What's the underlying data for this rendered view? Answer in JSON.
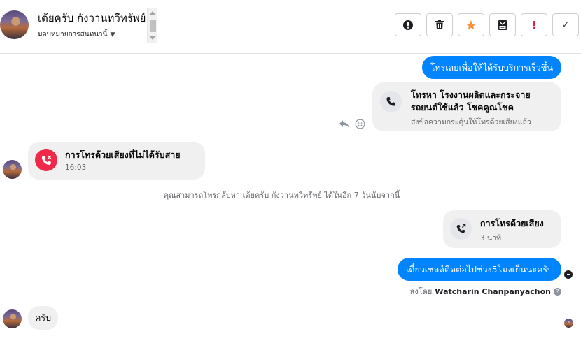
{
  "header": {
    "contact_name": "เด้ยครับ กังวานทวีทรัพย์",
    "assign_label": "มอบหมายการสนทนานี้",
    "toolbar": [
      {
        "name": "spam-button",
        "icon": "alert-circle-icon",
        "glyph": "!"
      },
      {
        "name": "delete-button",
        "icon": "trash-icon",
        "glyph": ""
      },
      {
        "name": "star-button",
        "icon": "star-icon",
        "glyph": "★"
      },
      {
        "name": "archive-button",
        "icon": "archive-mail-icon",
        "glyph": ""
      },
      {
        "name": "mark-important-button",
        "icon": "exclamation-icon",
        "glyph": "!"
      },
      {
        "name": "mark-done-button",
        "icon": "check-icon",
        "glyph": "✓"
      }
    ]
  },
  "messages": {
    "call_prompt": "โทรเลยเพื่อให้ได้รับบริการเร็วขึ้น",
    "call_card": {
      "title_line1": "โทรหา โรงงานผลิตและกระจาย",
      "title_line2": "รถยนต์ใช้แล้ว โชคคูณโชค",
      "subtitle": "ส่งข้อความกระตุ้นให้โทรด้วยเสียงแล้ว"
    },
    "missed_call": {
      "title": "การโทรด้วยเสียงที่ไม่ได้รับสาย",
      "time": "16:03"
    },
    "callback_note": "คุณสามารถโทรกลับหา เด้ยครับ กังวานทวีทรัพย์ ได้ในอีก 7 วันนับจากนี้",
    "voice_call": {
      "title": "การโทรด้วยเสียง",
      "duration": "3 นาที"
    },
    "followup_message": "เดี๋ยวเซลล์ติดต่อไปช่วง5โมงเย็นนะครับ",
    "sent_by_label": "ส่งโดย",
    "sent_by_name": "Watcharin Chanpanyachon",
    "reply_message": "ครับ"
  },
  "colors": {
    "accent_blue": "#0084ff",
    "missed_red": "#f02849",
    "star_orange": "#f7923b",
    "important_red": "#e41e3f"
  }
}
